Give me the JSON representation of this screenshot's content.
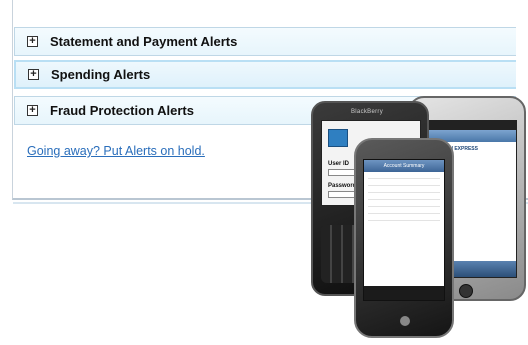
{
  "accordion": [
    {
      "label": "Statement and Payment Alerts",
      "expander": "+"
    },
    {
      "label": "Spending Alerts",
      "expander": "+"
    },
    {
      "label": "Fraud Protection Alerts",
      "expander": "+"
    }
  ],
  "hold_link": "Going away? Put Alerts on hold.",
  "promo": {
    "blackberry_brand": "BlackBerry",
    "bb_user_label": "User ID",
    "bb_password_label": "Password",
    "iphone_title": "AMERICAN EXPRESS",
    "android_header": "Account Summary"
  },
  "colors": {
    "link": "#2a6ebb",
    "row_bg": "#e7f5fc",
    "row_border": "#bfd7e6"
  }
}
